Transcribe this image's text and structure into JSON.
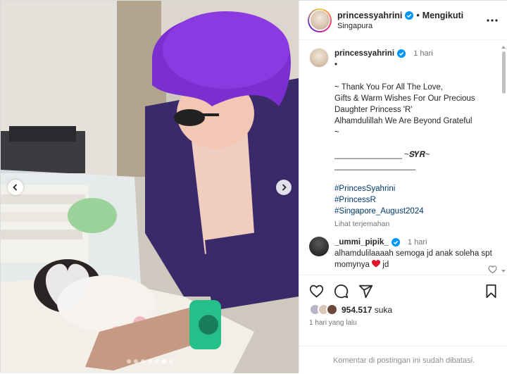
{
  "post": {
    "username": "princessyahrini",
    "follow_separator": "•",
    "follow_label": "Mengikuti",
    "location": "Singapura"
  },
  "caption": {
    "username": "princessyahrini",
    "time": "1 hari",
    "lines": [
      "•",
      "",
      "~ Thank You For All The Love,",
      "Gifts & Warm Wishes For Our Precious",
      "Daughter Princess 'R'",
      "Alhamdulillah We Are Beyond Grateful",
      "~",
      "",
      "_______________ ~𝑺𝒀𝑹~",
      "__________________",
      ""
    ],
    "hashtags": [
      "#PrincesSyahrini",
      "#PrincessR",
      "#Singapore_August2024"
    ],
    "translate_label": "Lihat terjemahan"
  },
  "comment": {
    "username": "_ummi_pipik_",
    "time": "1 hari",
    "text": "alhamdulilaaaah semoga jd anak soleha spt momynya",
    "text_cont": "jd"
  },
  "likes": {
    "count_text": "954.517",
    "suffix": "suka"
  },
  "posted_ago": "1 hari yang lalu",
  "comments_disabled": "Komentar di postingan ini sudah dibatasi.",
  "carousel": {
    "slide_count": 7,
    "active_index": 5
  },
  "colors": {
    "hair": "#7b2fd0",
    "link": "#00376b",
    "verified": "#0095f6",
    "heart": "#e0162b"
  },
  "icons": [
    "chevron-left-icon",
    "chevron-right-icon",
    "more-icon",
    "verified-icon",
    "heart-icon",
    "comment-icon",
    "share-icon",
    "bookmark-icon",
    "red-heart-emoji-icon"
  ]
}
